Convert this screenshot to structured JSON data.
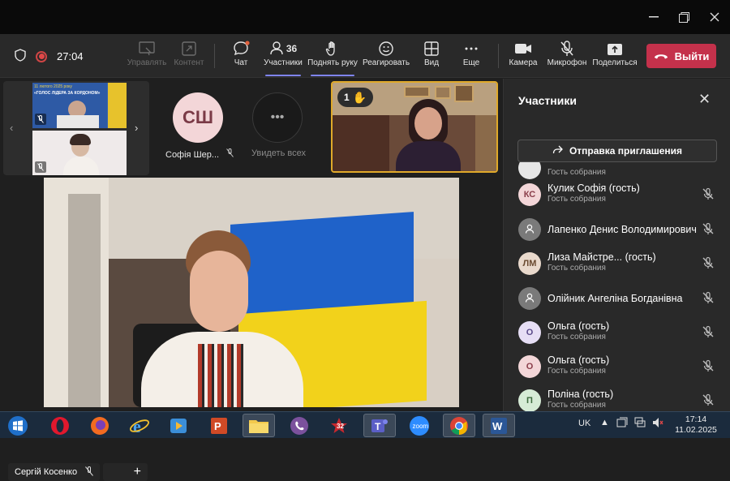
{
  "window": {
    "min_icon": "minimize-icon",
    "max_icon": "maximize-icon",
    "close_icon": "close-icon"
  },
  "toolbar": {
    "timer": "27:04",
    "manage_label": "Управлять",
    "content_label": "Контент",
    "chat_label": "Чат",
    "participants_label": "Участники",
    "participants_count": "36",
    "raise_hand_label": "Поднять руку",
    "react_label": "Реагировать",
    "view_label": "Вид",
    "more_label": "Еще",
    "camera_label": "Камера",
    "mic_label": "Микрофон",
    "share_label": "Поделиться",
    "leave_label": "Выйти",
    "leave_color": "#c4314b",
    "accent_color": "#7f85f5"
  },
  "stage": {
    "thumb_banner_line1": "11 лютого 2025 року",
    "thumb_banner_line2": "«ГОЛОС ЛІДЕРА ЗА КОРДОНОМ»",
    "avatar_tile": {
      "initials": "СШ",
      "name": "Софія Шер...",
      "color": "#f3d6d8"
    },
    "see_all_label": "Увидеть всех",
    "raised_hands": "1",
    "main_speaker": "Сергій Косенко",
    "flag_blue": "#1f62c9",
    "flag_yellow": "#f2d21b",
    "hand_badge_color": "#e0a92a"
  },
  "panel": {
    "title": "Участники",
    "invite_label": "Отправка приглашения",
    "partial_role": "Гость собрания",
    "participants": [
      {
        "initials": "КС",
        "name": "Кулик Софія (гость)",
        "role": "Гость собрания",
        "avatar_color": "#f3d6d8",
        "text_color": "#8a3d4a",
        "muted": true
      },
      {
        "initials": "",
        "name": "Лапенко Денис Володимирович",
        "role": "",
        "avatar_color": "#7a7a7a",
        "text_color": "#ffffff",
        "muted": true
      },
      {
        "initials": "ЛМ",
        "name": "Лиза Майстре...  (гость)",
        "role": "Гость собрания",
        "avatar_color": "#e9d9cc",
        "text_color": "#6a4a30",
        "muted": true
      },
      {
        "initials": "",
        "name": "Олійник Ангеліна Богданівна",
        "role": "",
        "avatar_color": "#7a7a7a",
        "text_color": "#ffffff",
        "muted": true
      },
      {
        "initials": "О",
        "name": "Ольга (гость)",
        "role": "Гость собрания",
        "avatar_color": "#e6def5",
        "text_color": "#5a4a8a",
        "muted": true
      },
      {
        "initials": "О",
        "name": "Ольга (гость)",
        "role": "Гость собрания",
        "avatar_color": "#f3d6d8",
        "text_color": "#8a3d4a",
        "muted": true
      },
      {
        "initials": "П",
        "name": "Поліна (гость)",
        "role": "Гость собрания",
        "avatar_color": "#d6ebd6",
        "text_color": "#3d6a3d",
        "muted": true
      }
    ]
  },
  "taskbar": {
    "apps": [
      "windows-start-icon",
      "opera-icon",
      "firefox-icon",
      "internet-explorer-icon",
      "media-player-icon",
      "powerpoint-icon",
      "file-explorer-icon",
      "viber-icon",
      "game-icon",
      "teams-icon",
      "zoom-icon",
      "chrome-icon",
      "word-icon"
    ],
    "game_badge": "32",
    "zoom_label": "zoom",
    "lang": "UK",
    "time": "17:14",
    "date": "11.02.2025"
  }
}
